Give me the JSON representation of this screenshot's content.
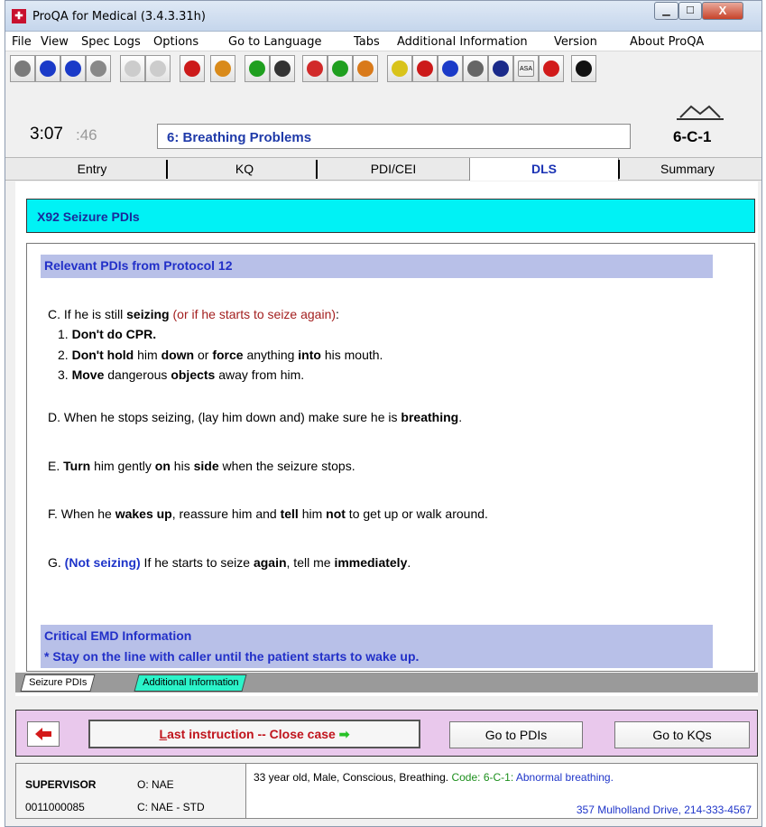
{
  "window": {
    "title": "ProQA for Medical (3.4.3.31h)",
    "app_icon": "proqa-logo-icon",
    "close_symbol": "X"
  },
  "menu": [
    {
      "label": "File",
      "key": "F"
    },
    {
      "label": "View",
      "key": "V"
    },
    {
      "label": "Spec Logs",
      "key": "L"
    },
    {
      "label": "Options",
      "key": "O"
    },
    {
      "label": "Go to Language",
      "key": "G"
    },
    {
      "label": "Tabs",
      "key": "T"
    },
    {
      "label": "Additional Information",
      "key": "A"
    },
    {
      "label": "Version",
      "key": "r"
    },
    {
      "label": "About ProQA",
      "key": "b"
    }
  ],
  "toolbar": [
    {
      "icon": "plus-icon",
      "color": "#7a7a7a"
    },
    {
      "icon": "minus-icon",
      "color": "#1a3ac8"
    },
    {
      "icon": "phone-icon",
      "color": "#1a3ac8"
    },
    {
      "icon": "clock-icon",
      "color": "#888888"
    },
    {
      "icon": "document-icon",
      "color": "#cccccc"
    },
    {
      "icon": "document-icon",
      "color": "#cccccc"
    },
    {
      "icon": "target-icon",
      "color": "#cc1a1a"
    },
    {
      "icon": "bottle-icon",
      "color": "#d98a1a"
    },
    {
      "icon": "updown-arrows-icon",
      "color": "#1f9f1f"
    },
    {
      "icon": "hazard-icon",
      "color": "#333333"
    },
    {
      "icon": "radiation-icon",
      "color": "#d12a2a"
    },
    {
      "icon": "gear-icon",
      "color": "#1f9f1f"
    },
    {
      "icon": "medal-icon",
      "color": "#d97a1a"
    },
    {
      "icon": "question-icon",
      "color": "#d9c31a"
    },
    {
      "icon": "heart-icon",
      "color": "#cc1a1a"
    },
    {
      "icon": "down-arrow-icon",
      "color": "#1a3ac8"
    },
    {
      "icon": "bicycle-icon",
      "color": "#666666"
    },
    {
      "icon": "face-icon",
      "color": "#1a2a8a"
    },
    {
      "icon": "asa-icon",
      "color": "#eeeeee",
      "label": "ASA"
    },
    {
      "icon": "record-icon",
      "color": "#d11a1a"
    },
    {
      "icon": "person-icon",
      "color": "#111111"
    }
  ],
  "header": {
    "time_main": "3:07",
    "time_sub": ":46",
    "chief_complaint": "6: Breathing Problems",
    "determinant_code": "6-C-1"
  },
  "tabs": [
    {
      "label": "Entry",
      "selected": false
    },
    {
      "label": "KQ",
      "selected": false
    },
    {
      "label": "PDI/CEI",
      "selected": false
    },
    {
      "label": "DLS",
      "selected": true
    },
    {
      "label": "Summary",
      "selected": false
    }
  ],
  "content": {
    "panel_title": "X92 Seizure PDIs",
    "section_title": "Relevant PDIs from Protocol 12",
    "line_c": {
      "pre": "C. If he is still ",
      "bold": "seizing",
      "red": " (or if he starts to seize again)",
      "post": ":"
    },
    "c1": {
      "num": "1. ",
      "bold": "Don't do CPR."
    },
    "c2": {
      "num": "2. ",
      "b1": "Don't hold",
      "t1": " him ",
      "b2": "down",
      "t2": " or ",
      "b3": "force",
      "t3": " anything ",
      "b4": "into",
      "t4": " his mouth."
    },
    "c3": {
      "num": "3. ",
      "b1": "Move",
      "t1": " dangerous ",
      "b2": "objects",
      "t2": " away from him."
    },
    "line_d": {
      "pre": "D. When he stops seizing, (lay him down and) make sure he is ",
      "bold": "breathing",
      "post": "."
    },
    "line_e": {
      "pre": "E. ",
      "b1": "Turn",
      "t1": " him gently ",
      "b2": "on",
      "t2": " his ",
      "b3": "side",
      "t3": " when the seizure stops."
    },
    "line_f": {
      "pre": "F. When he ",
      "b1": "wakes up",
      "t1": ", reassure him and ",
      "b2": "tell",
      "t2": " him ",
      "b3": "not",
      "t3": " to get up or walk around."
    },
    "line_g": {
      "pre": "G. ",
      "blue": "(Not seizing)",
      "t1": " If he starts to seize ",
      "b1": "again",
      "t2": ", tell me ",
      "b2": "immediately",
      "t3": "."
    },
    "critical_title": "Critical EMD Information",
    "critical_text": "* Stay on the line with caller until the patient starts to wake up."
  },
  "subtabs": [
    "Seizure PDIs",
    "Additional Information"
  ],
  "actions": {
    "back_icon": "red-left-arrow-icon",
    "last_pre": "L",
    "last_text": "ast instruction -- Close case",
    "last_arrow": "➡",
    "go_pdis": "Go to PDIs",
    "go_kqs": "Go to KQs"
  },
  "status": {
    "role": "SUPERVISOR",
    "id": "0011000085",
    "o_field": "O: NAE",
    "c_field": "C: NAE - STD",
    "summary_text": "33 year old, Male, Conscious, Breathing.",
    "code_label": "Code:",
    "code_value": "6-C-1:",
    "code_desc": "Abnormal breathing.",
    "address": "357 Mulholland Drive,  214-333-4567"
  },
  "colors": {
    "accent_cyan": "#00f2f5",
    "section_blue": "#b8c0e8",
    "action_pink": "#e9c8ec",
    "primary_blue": "#1f35c9",
    "alert_red": "#c0141c"
  }
}
